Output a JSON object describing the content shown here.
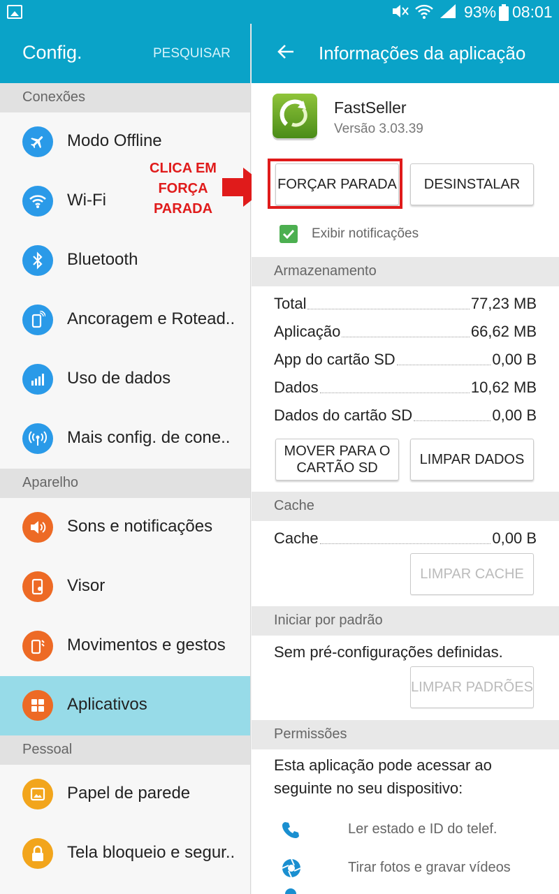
{
  "status_bar": {
    "battery": "93%",
    "time": "08:01",
    "icons": [
      "gallery-icon",
      "mute-icon",
      "wifi-icon",
      "signal-icon",
      "battery-icon"
    ]
  },
  "settings": {
    "title": "Config.",
    "search_label": "PESQUISAR",
    "sections": [
      {
        "header": "Conexões",
        "items": [
          {
            "label": "Modo Offline",
            "icon": "airplane-icon"
          },
          {
            "label": "Wi-Fi",
            "icon": "wifi-icon"
          },
          {
            "label": "Bluetooth",
            "icon": "bluetooth-icon"
          },
          {
            "label": "Ancoragem e Rotead..",
            "icon": "tethering-icon"
          },
          {
            "label": "Uso de dados",
            "icon": "data-usage-icon"
          },
          {
            "label": "Mais config. de cone..",
            "icon": "more-connections-icon"
          }
        ]
      },
      {
        "header": "Aparelho",
        "items": [
          {
            "label": "Sons e notificações",
            "icon": "speaker-icon"
          },
          {
            "label": "Visor",
            "icon": "display-icon"
          },
          {
            "label": "Movimentos e gestos",
            "icon": "motion-icon"
          },
          {
            "label": "Aplicativos",
            "icon": "apps-icon"
          }
        ]
      },
      {
        "header": "Pessoal",
        "items": [
          {
            "label": "Papel de parede",
            "icon": "wallpaper-icon"
          },
          {
            "label": "Tela bloqueio e segur..",
            "icon": "lock-icon"
          }
        ]
      }
    ]
  },
  "annotation": {
    "line1": "CLICA EM",
    "line2": "FORÇA",
    "line3": "PARADA"
  },
  "app_info": {
    "title": "Informações da aplicação",
    "app_name": "FastSeller",
    "version": "Versão 3.03.39",
    "force_stop": "FORÇAR PARADA",
    "uninstall": "DESINSTALAR",
    "show_notifications": "Exibir notificações",
    "storage": {
      "header": "Armazenamento",
      "rows": [
        {
          "label": "Total",
          "value": "77,23 MB"
        },
        {
          "label": "Aplicação",
          "value": "66,62 MB"
        },
        {
          "label": "App do cartão SD",
          "value": "0,00 B"
        },
        {
          "label": "Dados",
          "value": "10,62 MB"
        },
        {
          "label": "Dados do cartão SD",
          "value": "0,00 B"
        }
      ],
      "move_sd_line1": "MOVER PARA O",
      "move_sd_line2": "CARTÃO SD",
      "clear_data": "LIMPAR DADOS"
    },
    "cache": {
      "header": "Cache",
      "label": "Cache",
      "value": "0,00 B",
      "clear_cache": "LIMPAR CACHE"
    },
    "defaults": {
      "header": "Iniciar por padrão",
      "text": "Sem pré-configurações definidas.",
      "clear_defaults": "LIMPAR PADRÕES"
    },
    "permissions": {
      "header": "Permissões",
      "intro_line1": "Esta aplicação pode acessar ao",
      "intro_line2": "seguinte no seu dispositivo:",
      "items": [
        {
          "label": "Ler estado e ID do telef.",
          "icon": "phone-icon"
        },
        {
          "label": "Tirar fotos e gravar vídeos",
          "icon": "camera-icon"
        }
      ]
    }
  },
  "colors": {
    "accent": "#0aa3c8",
    "selected": "#97dbe8",
    "icon_blue": "#2a9ae8",
    "icon_orange": "#ed6a25",
    "icon_yellow": "#f2a51c",
    "annotation_red": "#e01b1b",
    "check_green": "#4caf50"
  }
}
